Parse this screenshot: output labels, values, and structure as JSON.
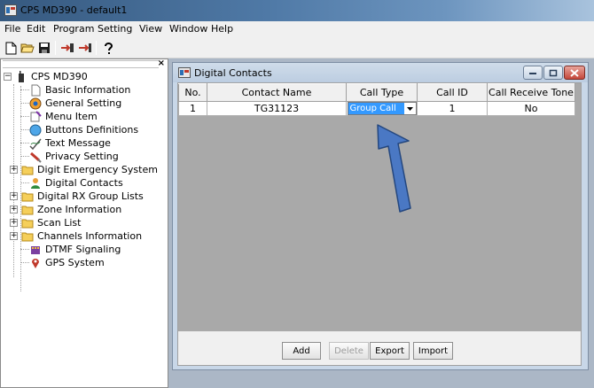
{
  "window": {
    "title": "CPS MD390 - default1"
  },
  "menu": [
    "File",
    "Edit",
    "Program",
    "Setting",
    "View",
    "Window",
    "Help"
  ],
  "toolbar": {
    "icons": [
      "new-file-icon",
      "open-folder-icon",
      "save-icon",
      "read-radio-icon",
      "write-radio-icon",
      "help-icon"
    ]
  },
  "tree": {
    "close_glyph": "×",
    "root": "CPS MD390",
    "items": [
      {
        "label": "Basic Information",
        "icon": "document-icon"
      },
      {
        "label": "General Setting",
        "icon": "gear-icon"
      },
      {
        "label": "Menu Item",
        "icon": "menu-icon"
      },
      {
        "label": "Buttons Definitions",
        "icon": "button-icon"
      },
      {
        "label": "Text Message",
        "icon": "message-icon"
      },
      {
        "label": "Privacy Setting",
        "icon": "key-icon"
      },
      {
        "label": "Digit Emergency System",
        "icon": "folder-icon",
        "expandable": true
      },
      {
        "label": "Digital Contacts",
        "icon": "contacts-icon"
      },
      {
        "label": "Digital RX Group Lists",
        "icon": "folder-icon",
        "expandable": true
      },
      {
        "label": "Zone Information",
        "icon": "folder-icon",
        "expandable": true
      },
      {
        "label": "Scan List",
        "icon": "folder-icon",
        "expandable": true
      },
      {
        "label": "Channels Information",
        "icon": "folder-icon",
        "expandable": true
      },
      {
        "label": "DTMF Signaling",
        "icon": "keypad-icon"
      },
      {
        "label": "GPS System",
        "icon": "gps-pin-icon"
      }
    ]
  },
  "contacts_window": {
    "title": "Digital Contacts",
    "columns": [
      "No.",
      "Contact Name",
      "Call Type",
      "Call ID",
      "Call Receive Tone"
    ],
    "rows": [
      {
        "no": "1",
        "name": "TG31123",
        "call_type": "Group Call",
        "call_id": "1",
        "receive_tone": "No"
      }
    ],
    "buttons": {
      "add": "Add",
      "delete": "Delete",
      "export": "Export",
      "import": "Import"
    }
  },
  "colors": {
    "selection": "#3399ff",
    "annotation_arrow": "#4a78c4",
    "mdi_background": "#abb7c6"
  }
}
